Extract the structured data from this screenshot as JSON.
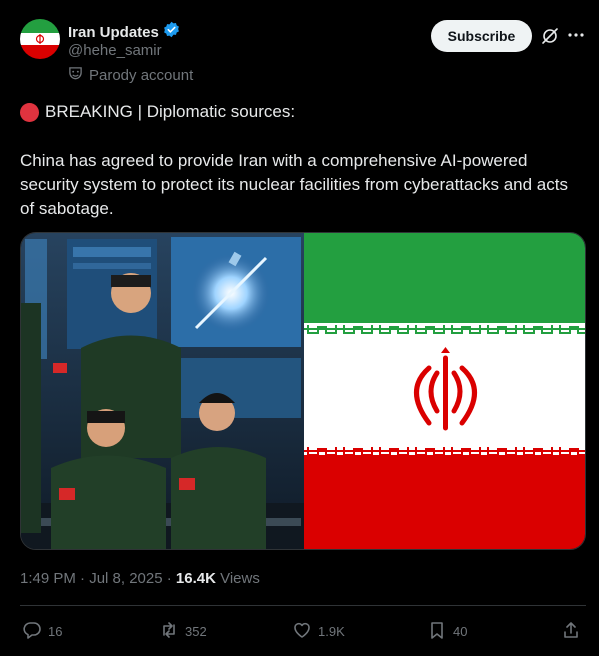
{
  "author": {
    "display_name": "Iran Updates",
    "handle": "@hehe_samir",
    "label": "Parody account",
    "verified": true
  },
  "header": {
    "subscribe_label": "Subscribe"
  },
  "post": {
    "headline": "BREAKING | Diplomatic sources:",
    "body": "China has agreed to provide Iran with a comprehensive AI-powered security system to protect its nuclear facilities from cyberattacks and acts of sabotage.",
    "timestamp": "1:49 PM · Jul 8, 2025 · ",
    "views_count": "16.4K",
    "views_label": " Views"
  },
  "actions": {
    "replies": "16",
    "reposts": "352",
    "likes": "1.9K",
    "bookmarks": "40"
  },
  "colors": {
    "background": "#000000",
    "verified_blue": "#1d9bf0",
    "breaking_red": "#e0333f",
    "flag_green": "#239f40",
    "flag_red": "#da0000",
    "muted_text": "#71767b"
  }
}
